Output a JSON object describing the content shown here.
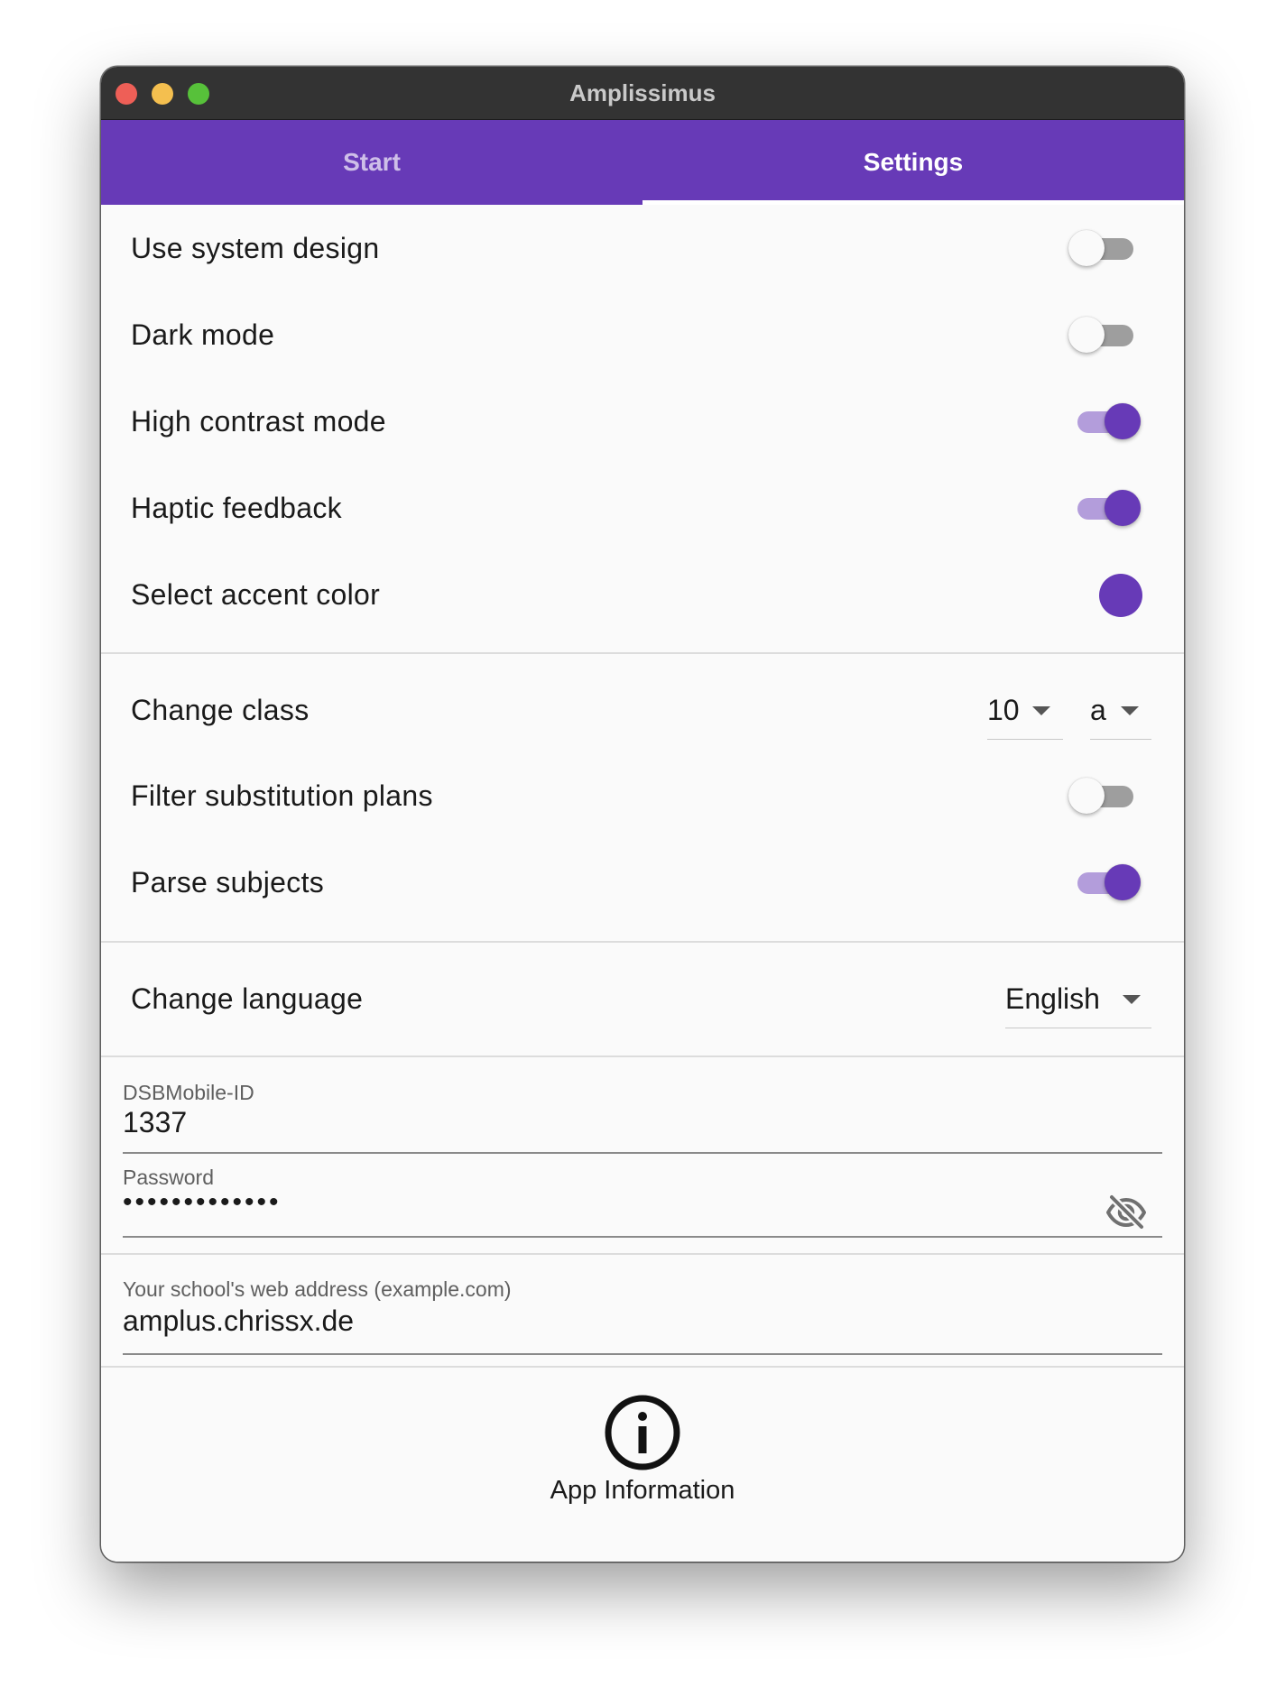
{
  "window": {
    "title": "Amplissimus"
  },
  "tabs": [
    {
      "label": "Start",
      "selected": false
    },
    {
      "label": "Settings",
      "selected": true
    }
  ],
  "colors": {
    "accent": "#673ab7",
    "accent_light": "#b39ddb",
    "switch_off_track": "#9e9e9e"
  },
  "design_settings": [
    {
      "label": "Use system design",
      "control": "switch",
      "on": false
    },
    {
      "label": "Dark mode",
      "control": "switch",
      "on": false
    },
    {
      "label": "High contrast mode",
      "control": "switch",
      "on": true
    },
    {
      "label": "Haptic feedback",
      "control": "switch",
      "on": true
    },
    {
      "label": "Select accent color",
      "control": "color",
      "color": "#673ab7"
    }
  ],
  "class_settings": {
    "change_class_label": "Change class",
    "grade_value": "10",
    "letter_value": "a",
    "filter_label": "Filter substitution plans",
    "filter_on": false,
    "parse_label": "Parse subjects",
    "parse_on": true
  },
  "language": {
    "label": "Change language",
    "value": "English"
  },
  "credentials": {
    "id_label": "DSBMobile-ID",
    "id_value": "1337",
    "password_label": "Password",
    "password_value": "•••••••••••••",
    "visibility_icon": "visibility-off-icon"
  },
  "school": {
    "label": "Your school's web address (example.com)",
    "value": "amplus.chrissx.de"
  },
  "app_info": {
    "icon": "info-icon",
    "label": "App Information"
  }
}
